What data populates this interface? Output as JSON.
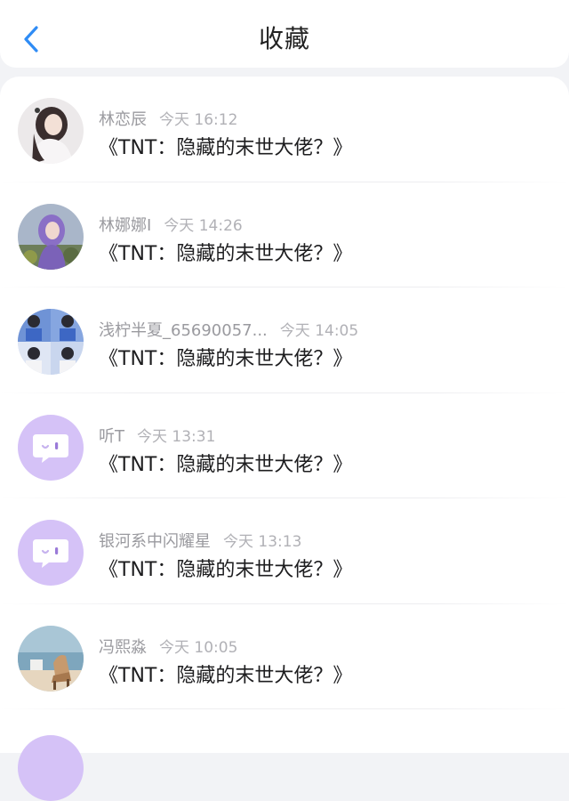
{
  "header": {
    "title": "收藏",
    "back_icon": "chevron-left-icon",
    "accent_color": "#2f8cf5"
  },
  "favorites": [
    {
      "user": "林恋辰",
      "time": "今天 16:12",
      "book": "《TNT：隐藏的末世大佬？》",
      "avatar": "photo-girl-white"
    },
    {
      "user": "林娜娜I",
      "time": "今天 14:26",
      "book": "《TNT：隐藏的末世大佬？》",
      "avatar": "photo-girl-purple"
    },
    {
      "user": "浅柠半夏_65690057...",
      "time": "今天 14:05",
      "book": "《TNT：隐藏的末世大佬？》",
      "avatar": "photo-group-blue"
    },
    {
      "user": "听T",
      "time": "今天 13:31",
      "book": "《TNT：隐藏的末世大佬？》",
      "avatar": "chat-bubble-icon"
    },
    {
      "user": "银河系中闪耀星",
      "time": "今天 13:13",
      "book": "《TNT：隐藏的末世大佬？》",
      "avatar": "chat-bubble-icon"
    },
    {
      "user": "冯熙淼",
      "time": "今天 10:05",
      "book": "《TNT：隐藏的末世大佬？》",
      "avatar": "photo-beach-chair"
    }
  ],
  "colors": {
    "default_avatar_bg": "#d5c2f7",
    "meta_text": "#9a9a9f",
    "page_bg": "#f2f3f6"
  }
}
